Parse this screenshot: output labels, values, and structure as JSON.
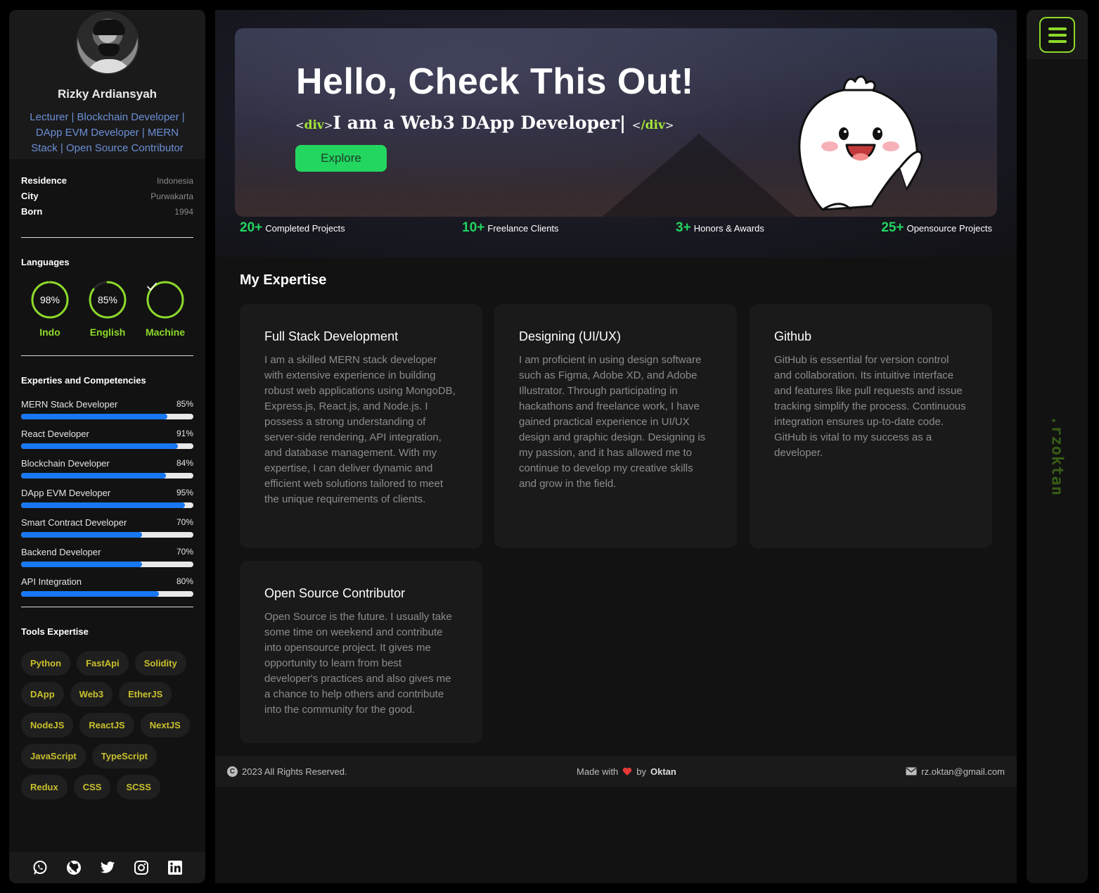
{
  "profile": {
    "name": "Rizky Ardiansyah",
    "title": "Lecturer | Blockchain Developer | DApp EVM Developer | MERN Stack | Open Source Contributor"
  },
  "info": [
    {
      "label": "Residence",
      "value": "Indonesia"
    },
    {
      "label": "City",
      "value": "Purwakarta"
    },
    {
      "label": "Born",
      "value": "1994"
    }
  ],
  "languages": {
    "title": "Languages",
    "items": [
      {
        "name": "Indo",
        "percent": "98%",
        "level": 0.98
      },
      {
        "name": "English",
        "percent": "85%",
        "level": 0.85
      },
      {
        "name": "Machine",
        "percent": "",
        "level": 1.0,
        "icon": "check-icon"
      }
    ]
  },
  "competencies": {
    "title": "Experties and Competencies",
    "items": [
      {
        "name": "MERN Stack Developer",
        "percent": "85%",
        "level": 0.85
      },
      {
        "name": "React Developer",
        "percent": "91%",
        "level": 0.91
      },
      {
        "name": "Blockchain Developer",
        "percent": "84%",
        "level": 0.84
      },
      {
        "name": "DApp EVM Developer",
        "percent": "95%",
        "level": 0.95
      },
      {
        "name": "Smart Contract Developer",
        "percent": "70%",
        "level": 0.7
      },
      {
        "name": "Backend Developer",
        "percent": "70%",
        "level": 0.7
      },
      {
        "name": "API Integration",
        "percent": "80%",
        "level": 0.8
      }
    ]
  },
  "tools": {
    "title": "Tools Expertise",
    "items": [
      "Python",
      "FastApi",
      "Solidity",
      "DApp",
      "Web3",
      "EtherJS",
      "NodeJS",
      "ReactJS",
      "NextJS",
      "JavaScript",
      "TypeScript",
      "Redux",
      "CSS",
      "SCSS"
    ]
  },
  "socials": [
    "whatsapp-icon",
    "github-icon",
    "twitter-icon",
    "instagram-icon",
    "linkedin-icon"
  ],
  "hero": {
    "title": "Hello, Check This Out!",
    "tag_open": "div",
    "tag_close": "/div",
    "subtitle": "I am a Web3 DApp Developer|",
    "button": "Explore"
  },
  "stats": [
    {
      "number": "20+",
      "label": "Completed Projects"
    },
    {
      "number": "10+",
      "label": "Freelance Clients"
    },
    {
      "number": "3+",
      "label": "Honors & Awards"
    },
    {
      "number": "25+",
      "label": "Opensource Projects"
    }
  ],
  "expertise": {
    "title": "My Expertise",
    "cards": [
      {
        "title": "Full Stack Development",
        "text": "I am a skilled MERN stack developer with extensive experience in building robust web applications using MongoDB, Express.js, React.js, and Node.js. I possess a strong understanding of server-side rendering, API integration, and database management. With my expertise, I can deliver dynamic and efficient web solutions tailored to meet the unique requirements of clients."
      },
      {
        "title": "Designing (UI/UX)",
        "text": "I am proficient in using design software such as Figma, Adobe XD, and Adobe Illustrator. Through participating in hackathons and freelance work, I have gained practical experience in UI/UX design and graphic design. Designing is my passion, and it has allowed me to continue to develop my creative skills and grow in the field."
      },
      {
        "title": "Github",
        "text": "GitHub is essential for version control and collaboration. Its intuitive interface and features like pull requests and issue tracking simplify the process. Continuous integration ensures up-to-date code. GitHub is vital to my success as a developer."
      },
      {
        "title": "Open Source Contributor",
        "text": "Open Source is the future. I usually take some time on weekend and contribute into opensource project. It gives me opportunity to learn from best developer's practices and also gives me a chance to help others and contribute into the community for the good."
      }
    ]
  },
  "footer": {
    "copyright": "2023 All Rights Reserved.",
    "made_with": "Made with",
    "by": "by",
    "author": "Oktan",
    "email": "rz.oktan@gmail.com"
  },
  "brand": ".rzoktan",
  "colors": {
    "accent": "#8dd92a",
    "green": "#22d65f",
    "bar": "#1877f2",
    "tag": "#c9c02c"
  }
}
